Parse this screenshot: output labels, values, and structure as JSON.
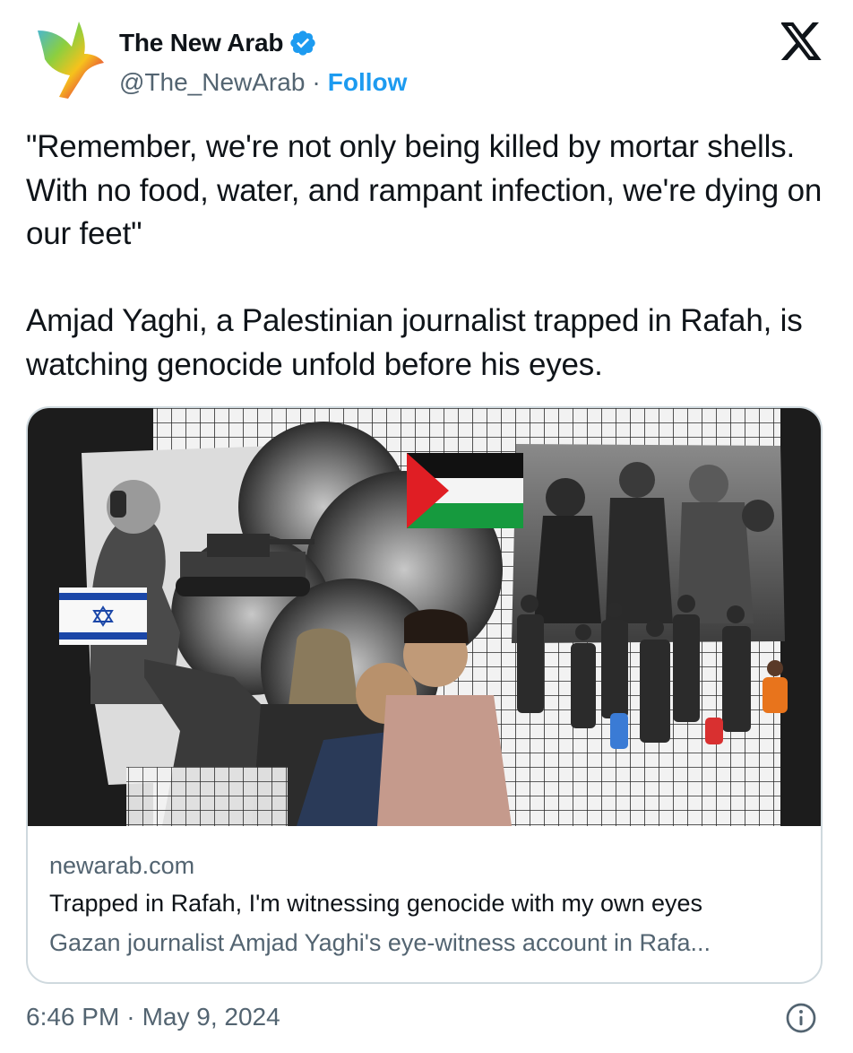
{
  "account": {
    "display_name": "The New Arab",
    "handle": "@The_NewArab",
    "separator": "·",
    "follow_label": "Follow",
    "verified": true,
    "avatar_icon": "rainbow-bird-logo",
    "verified_color": "#1d9bf0"
  },
  "platform": {
    "logo_icon": "x-logo"
  },
  "tweet": {
    "text": "\"Remember, we're not only being killed by mortar shells. With no food, water, and rampant infection, we're dying on our feet\"\n\nAmjad Yaghi, a Palestinian journalist trapped in Rafah, is watching genocide unfold before his eyes."
  },
  "card": {
    "image_icon": "collage-image",
    "domain": "newarab.com",
    "title": "Trapped in Rafah, I'm witnessing genocide with my own eyes",
    "description": "Gazan journalist Amjad Yaghi's eye-witness account in Rafa..."
  },
  "footer": {
    "time": "6:46 PM",
    "separator": "·",
    "date": "May 9, 2024",
    "info_icon": "info-icon"
  },
  "colors": {
    "text_primary": "#0f1419",
    "text_secondary": "#536471",
    "link": "#1d9bf0",
    "border": "#cfd9de"
  }
}
